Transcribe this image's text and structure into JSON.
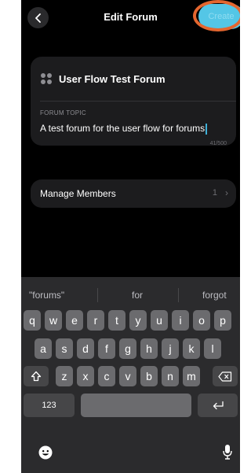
{
  "header": {
    "title": "Edit Forum",
    "create_label": "Create"
  },
  "forum": {
    "name": "User Flow Test Forum",
    "topic_label": "FORUM TOPIC",
    "topic_value": "A test forum for the user flow for forums",
    "char_count": "41/500"
  },
  "members": {
    "label": "Manage Members",
    "count": "1"
  },
  "keyboard": {
    "suggestions": [
      "\"forums\"",
      "for",
      "forgot"
    ],
    "row1": [
      "q",
      "w",
      "e",
      "r",
      "t",
      "y",
      "u",
      "i",
      "o",
      "p"
    ],
    "row2": [
      "a",
      "s",
      "d",
      "f",
      "g",
      "h",
      "j",
      "k",
      "l"
    ],
    "row3": [
      "z",
      "x",
      "c",
      "v",
      "b",
      "n",
      "m"
    ],
    "numbers_label": "123"
  },
  "colors": {
    "accent": "#54c6e6",
    "highlight": "#e4662f"
  }
}
